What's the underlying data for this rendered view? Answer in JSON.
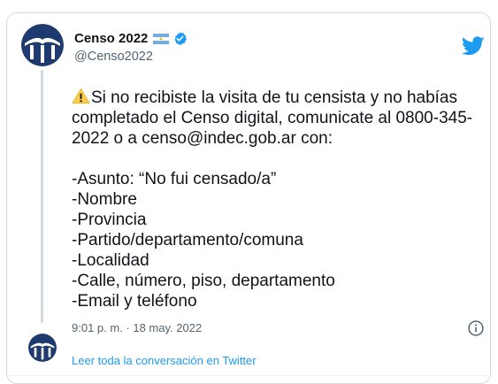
{
  "tweet": {
    "author_name": "Censo 2022",
    "author_flag": "argentina-flag-icon",
    "verified": true,
    "handle": "@Censo2022",
    "body_lines": [
      "Si no recibiste la visita de tu censista y no habías completado el Censo digital, comunicate al 0800-345-2022 o a censo@indec.gob.ar con:"
    ],
    "list_items": [
      "-Asunto: “No fui censado/a”",
      "-Nombre",
      "-Provincia",
      "-Partido/departamento/comuna",
      "-Localidad",
      "-Calle, número, piso, departamento",
      "-Email y teléfono"
    ],
    "timestamp": "9:01 p. m. · 18 may. 2022"
  },
  "footer": {
    "read_conversation_label": "Leer toda la conversación en Twitter"
  },
  "colors": {
    "twitter_blue": "#1d9bf0",
    "logo_navy": "#1f3a6e",
    "secondary_text": "#536471",
    "border": "#cfd9de"
  }
}
